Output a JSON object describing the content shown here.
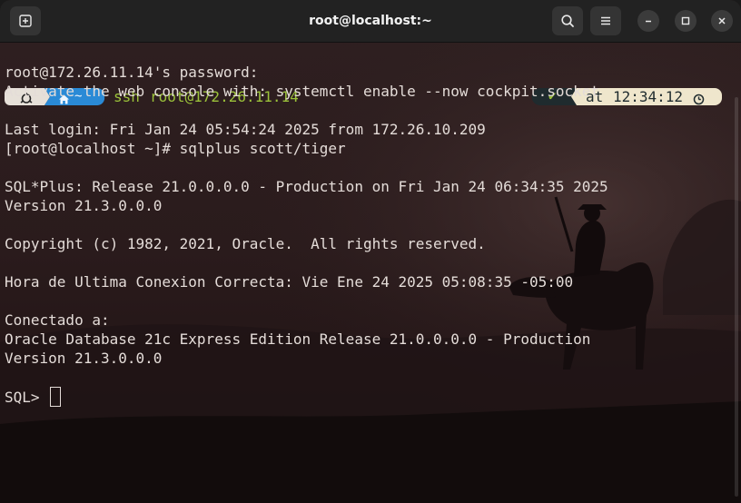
{
  "window": {
    "title": "root@localhost:~"
  },
  "prompt": {
    "os_icon": "linux-icon",
    "home_icon": "home-icon",
    "dir": "~",
    "command_keyword": "ssh",
    "command_arg": "root@172.26.11.14",
    "status_check": "✔",
    "time_prefix": "at",
    "time": "12:34:12",
    "clock_icon": "clock-icon",
    "colors": {
      "os_segment": "#e6e0d8",
      "dir_segment": "#2a8ad6",
      "command_green": "#9bc23a",
      "status_segment": "#1f2b2e",
      "time_segment": "#efe6cc"
    }
  },
  "terminal": {
    "lines": [
      "root@172.26.11.14's password:",
      "Activate the web console with: systemctl enable --now cockpit.socket",
      "",
      "Last login: Fri Jan 24 05:54:24 2025 from 172.26.10.209",
      "[root@localhost ~]# sqlplus scott/tiger",
      "",
      "SQL*Plus: Release 21.0.0.0.0 - Production on Fri Jan 24 06:34:35 2025",
      "Version 21.3.0.0.0",
      "",
      "Copyright (c) 1982, 2021, Oracle.  All rights reserved.",
      "",
      "Hora de Ultima Conexion Correcta: Vie Ene 24 2025 05:08:35 -05:00",
      "",
      "Conectado a:",
      "Oracle Database 21c Express Edition Release 21.0.0.0.0 - Production",
      "Version 21.3.0.0.0",
      ""
    ],
    "sql_prompt": "SQL> "
  }
}
